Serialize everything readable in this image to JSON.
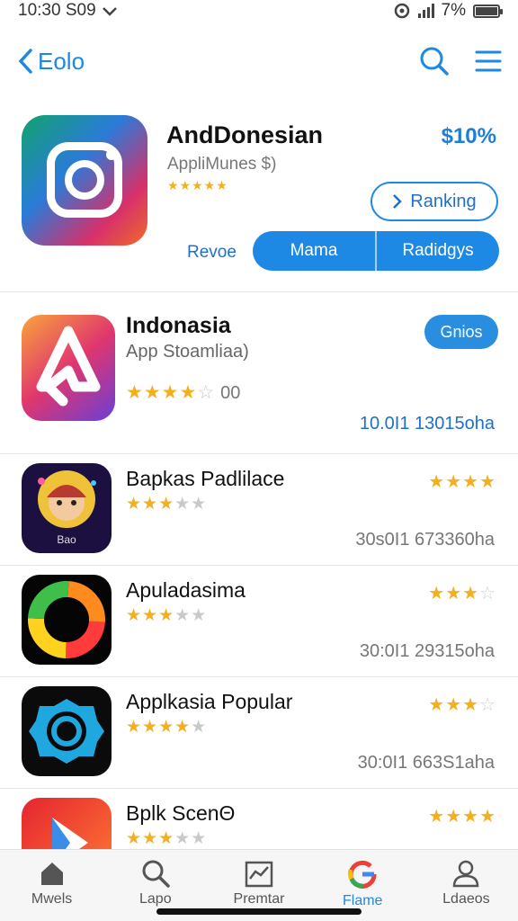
{
  "status_bar": {
    "time": "10:30 S09",
    "battery": "7%"
  },
  "nav": {
    "back_label": "Eolo"
  },
  "hero": {
    "title": "AndDonesian",
    "price": "$10%",
    "subtitle": "AppliMunes $)",
    "stars": "★★★★★",
    "rank_button": "Ranking",
    "tab_plain": "Revoe",
    "segment_1": "Mama",
    "segment_2": "Radidgys"
  },
  "apps": [
    {
      "title": "Indonasia",
      "subtitle": "App Stoamliaa)",
      "stars": "★★★★",
      "stars_muted": "☆",
      "rating": "00",
      "get_label": "Gnios",
      "meta": "10.0I1  13015oha"
    },
    {
      "title": "Bapkas Padlilace",
      "stars": "★★★",
      "stars_muted": "★★",
      "right_stars": "★★★★",
      "right_stars_muted": "",
      "meta": "30s0I1  673360ha",
      "badge": "Bao"
    },
    {
      "title": "Apuladasima",
      "stars": "★★★",
      "stars_muted": "★★",
      "right_stars": "★★★",
      "right_stars_muted": "☆",
      "meta": "30:0I1  29315oha"
    },
    {
      "title": "Applkasia Popular",
      "stars": "★★★★",
      "stars_muted": "★",
      "right_stars": "★★★",
      "right_stars_muted": "☆",
      "meta": "30:0I1  663S1aha"
    },
    {
      "title": "Bplk ScenΘ",
      "stars": "★★★",
      "stars_muted": "★★",
      "right_stars": "★★★★",
      "right_stars_muted": "",
      "meta": ""
    }
  ],
  "bottom_tabs": [
    {
      "label": "Mwels",
      "icon": "home-icon"
    },
    {
      "label": "Lapo",
      "icon": "search-icon"
    },
    {
      "label": "Premtar",
      "icon": "chart-icon"
    },
    {
      "label": "Flame",
      "icon": "google-icon"
    },
    {
      "label": "Ldaeos",
      "icon": "person-icon"
    }
  ],
  "colors": {
    "accent": "#1e88e5",
    "star": "#f2b01e"
  }
}
